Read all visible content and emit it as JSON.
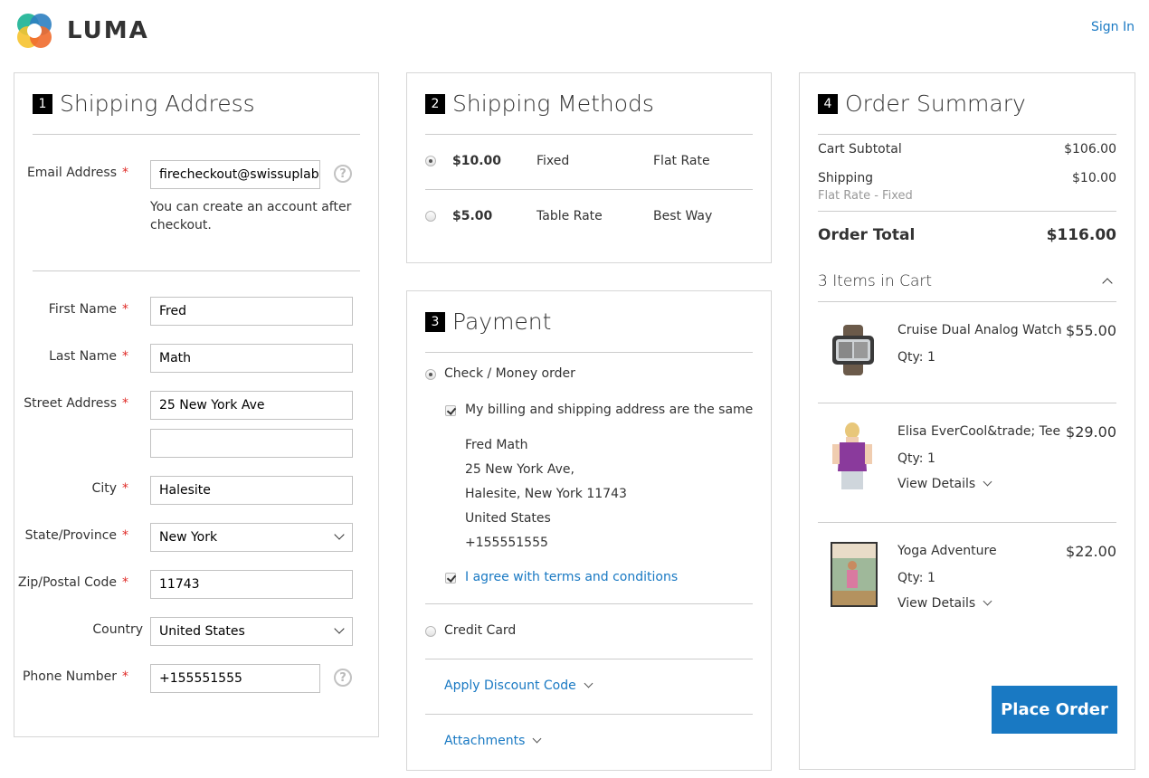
{
  "header": {
    "brand": "LUMA",
    "sign_in": "Sign In"
  },
  "shipping_address": {
    "step": "1",
    "title": "Shipping Address",
    "email": {
      "label": "Email Address",
      "value": "firecheckout@swissuplabs.com",
      "note": "You can create an account after checkout."
    },
    "first_name": {
      "label": "First Name",
      "value": "Fred"
    },
    "last_name": {
      "label": "Last Name",
      "value": "Math"
    },
    "street": {
      "label": "Street Address",
      "value": "25 New York Ave",
      "value2": ""
    },
    "city": {
      "label": "City",
      "value": "Halesite"
    },
    "state": {
      "label": "State/Province",
      "value": "New York"
    },
    "zip": {
      "label": "Zip/Postal Code",
      "value": "11743"
    },
    "country": {
      "label": "Country",
      "value": "United States"
    },
    "phone": {
      "label": "Phone Number",
      "value": "+155551555"
    },
    "required_mark": "*",
    "help_glyph": "?"
  },
  "shipping_methods": {
    "step": "2",
    "title": "Shipping Methods",
    "rates": [
      {
        "price": "$10.00",
        "method": "Fixed",
        "carrier": "Flat Rate",
        "selected": true
      },
      {
        "price": "$5.00",
        "method": "Table Rate",
        "carrier": "Best Way",
        "selected": false
      }
    ]
  },
  "payment": {
    "step": "3",
    "title": "Payment",
    "check_label": "Check / Money order",
    "same_address_label": "My billing and shipping address are the same",
    "address_lines": [
      "Fred Math",
      "25 New York Ave,",
      "Halesite, New York 11743",
      "United States",
      "+155551555"
    ],
    "terms_label": "I agree with terms and conditions",
    "credit_card_label": "Credit Card",
    "discount_label": "Apply Discount Code",
    "attachments_label": "Attachments"
  },
  "order_summary": {
    "step": "4",
    "title": "Order Summary",
    "subtotal_label": "Cart Subtotal",
    "subtotal_value": "$106.00",
    "shipping_label": "Shipping",
    "shipping_value": "$10.00",
    "shipping_method": "Flat Rate - Fixed",
    "total_label": "Order Total",
    "total_value": "$116.00",
    "items_heading": "3 Items in Cart",
    "items": [
      {
        "name": "Cruise Dual Analog Watch",
        "price": "$55.00",
        "qty": "Qty: 1",
        "details": ""
      },
      {
        "name": "Elisa EverCool&trade; Tee",
        "price": "$29.00",
        "qty": "Qty: 1",
        "details": "View Details"
      },
      {
        "name": "Yoga Adventure",
        "price": "$22.00",
        "qty": "Qty: 1",
        "details": "View Details"
      }
    ],
    "place_order": "Place Order"
  },
  "colors": {
    "accent": "#1979c3",
    "required": "#e02b27"
  }
}
